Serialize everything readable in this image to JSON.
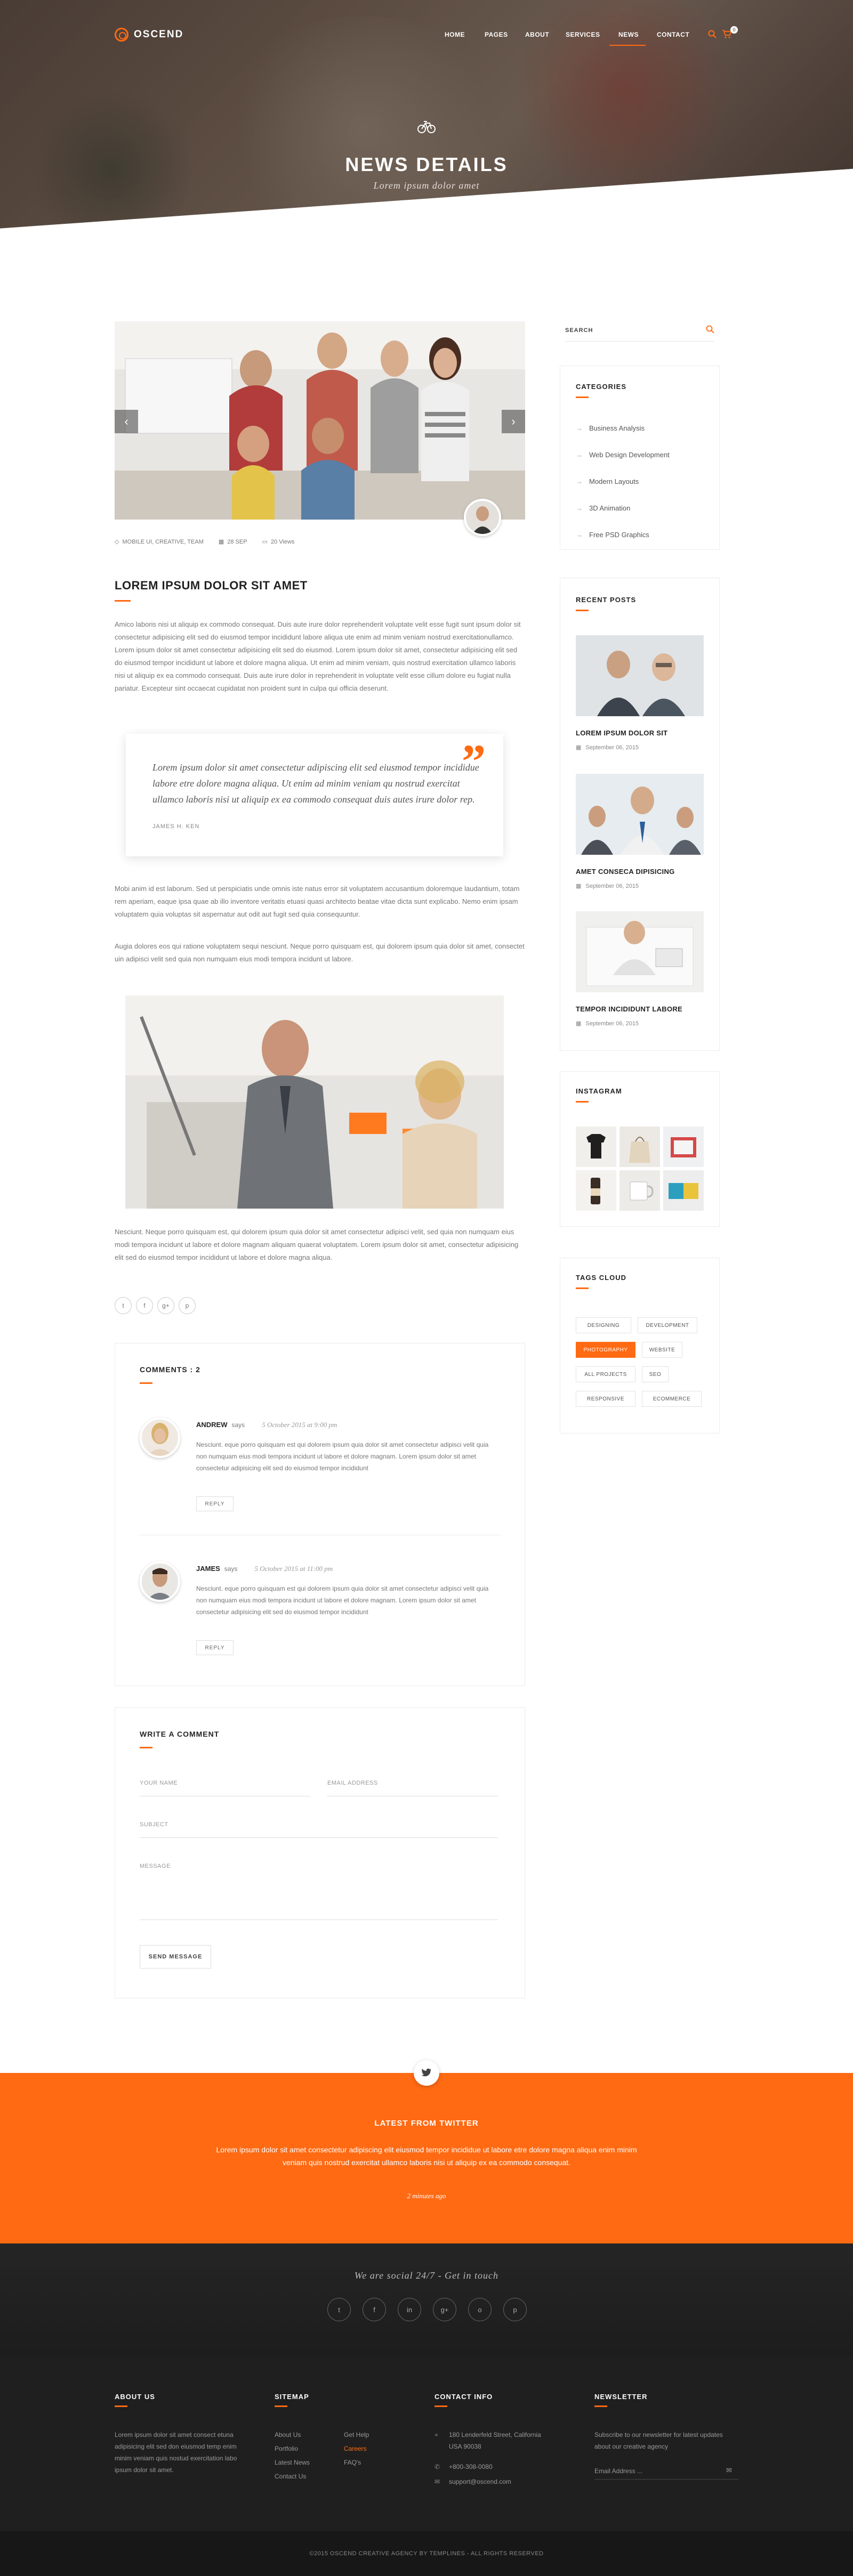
{
  "brand": {
    "name": "OSCEND",
    "accent": "#ff6a13"
  },
  "nav": {
    "items": [
      "HOME",
      "PAGES",
      "ABOUT",
      "SERVICES",
      "NEWS",
      "CONTACT"
    ],
    "active": "NEWS",
    "cart_count": "0"
  },
  "hero": {
    "title": "NEWS DETAILS",
    "subtitle": "Lorem ipsum dolor amet"
  },
  "post": {
    "meta": {
      "categories": "MOBILE UI, CREATIVE, TEAM",
      "date": "28 SEP",
      "views": "20 Views"
    },
    "title": "LOREM IPSUM DOLOR SIT AMET",
    "para1": "Amico laboris nisi ut aliquip ex commodo consequat. Duis aute irure dolor reprehenderit voluptate velit esse fugit sunt ipsum dolor sit consectetur adipisicing elit sed do eiusmod tempor incididunt labore aliqua ute enim ad minim veniam nostrud exercitationullamco. Lorem ipsum dolor sit amet consectetur adipisicing elit sed do eiusmod. Lorem ipsum dolor sit amet, consectetur adipisicing elit sed do eiusmod tempor incididunt ut labore et dolore magna aliqua. Ut enim ad minim veniam, quis nostrud exercitation ullamco laboris nisi ut aliquip ex ea commodo consequat. Duis aute irure dolor in reprehenderit in voluptate velit esse cillum dolore eu fugiat nulla pariatur. Excepteur sint occaecat cupidatat non proident sunt in culpa qui officia deserunt.",
    "quote": {
      "text": "Lorem ipsum dolor sit amet consectetur adipiscing elit sed eiusmod tempor incididue labore etre dolore magna aliqua. Ut enim ad minim veniam qu nostrud exercitat ullamco laboris nisi ut aliquip ex ea commodo consequat duis autes irure dolor rep.",
      "author": "JAMES H. KEN"
    },
    "para2": "Mobi anim id est laborum. Sed ut perspiciatis unde omnis iste natus error sit voluptatem accusantium doloremque laudantium, totam rem aperiam, eaque ipsa quae ab illo inventore veritatis etuasi quasi architecto beatae vitae dicta sunt explicabo. Nemo enim ipsam voluptatem quia voluptas sit aspernatur aut odit aut fugit sed quia consequuntur.",
    "para3": "Augia dolores eos qui ratione voluptatem sequi nesciunt. Neque porro quisquam est, qui dolorem ipsum quia dolor sit amet, consectet uin adipisci velit sed quia non numquam eius modi tempora incidunt ut labore.",
    "para4": "Nesciunt. Neque porro quisquam est, qui dolorem ipsum quia dolor sit amet consectetur adipisci velit, sed quia non numquam eius modi tempora incidunt ut labore et dolore magnam aliquam quaerat voluptatem. Lorem ipsum dolor sit amet, consectetur adipisicing elit sed do eiusmod tempor incididunt ut labore et dolore magna aliqua.",
    "share": [
      "t",
      "f",
      "g+",
      "p"
    ]
  },
  "comments": {
    "title": "COMMENTS : 2",
    "says": "says",
    "reply": "REPLY",
    "items": [
      {
        "name": "ANDREW",
        "date": "5 October 2015 at 9:00 pm",
        "text": "Nesciunt. eque porro quisquam est qui dolorem ipsum quia dolor sit amet consectetur adipisci velit quia non numquam eius modi tempora incidunt ut labore et dolore magnam. Lorem ipsum dolor sit amet consectetur adipisicing elit sed do eiusmod tempor incididunt"
      },
      {
        "name": "JAMES",
        "date": "5 October 2015 at 11:00 pm",
        "text": "Nesciunt. eque porro quisquam est qui dolorem ipsum quia dolor sit amet consectetur adipisci velit quia non numquam eius modi tempora incidunt ut labore et dolore magnam. Lorem ipsum dolor sit amet consectetur adipisicing elit sed do eiusmod tempor incididunt"
      }
    ]
  },
  "form": {
    "title": "WRITE A COMMENT",
    "name": "YOUR NAME",
    "email": "EMAIL ADDRESS",
    "subject": "SUBJECT",
    "message": "MESSAGE",
    "button": "SEND MESSAGE"
  },
  "sidebar": {
    "search": "SEARCH",
    "categories_title": "CATEGORIES",
    "categories": [
      "Business Analysis",
      "Web Design Development",
      "Modern Layouts",
      "3D Animation",
      "Free PSD Graphics"
    ],
    "recent_title": "RECENT POSTS",
    "recent": [
      {
        "title": "LOREM IPSUM DOLOR SIT",
        "date": "September 06, 2015"
      },
      {
        "title": "AMET CONSECA DIPISICING",
        "date": "September 06, 2015"
      },
      {
        "title": "TEMPOR INCIDIDUNT LABORE",
        "date": "September 06, 2015"
      }
    ],
    "instagram_title": "INSTAGRAM",
    "tags_title": "TAGS CLOUD",
    "tags": [
      "DESIGNING",
      "DEVELOPMENT",
      "PHOTOGRAPHY",
      "WEBSITE",
      "ALL PROJECTS",
      "SEO",
      "RESPONSIVE",
      "ECOMMERCE"
    ],
    "active_tag": "PHOTOGRAPHY"
  },
  "twitter": {
    "title": "LATEST FROM TWITTER",
    "text": "Lorem ipsum dolor sit amet consectetur adipiscing elit eiusmod tempor incididue ut labore etre dolore magna aliqua enim minim veniam quis nostrud exercitat ullamco laboris nisi ut aliquip ex ea commodo consequat.",
    "time": "2 minutes ago"
  },
  "social": {
    "title": "We are social 24/7 - Get in touch",
    "icons": [
      "t",
      "f",
      "in",
      "g+",
      "o",
      "p"
    ]
  },
  "footer": {
    "about_title": "ABOUT US",
    "about_text": "Lorem ipsum dolor sit amet consect etuna adipisicing elit sed don eiusmod temp enim minim veniam quis nostud exercitation labo ipsum dolor sit amet.",
    "sitemap_title": "SITEMAP",
    "sitemap_col1": [
      "About Us",
      "Portfolio",
      "Latest News",
      "Contact Us"
    ],
    "sitemap_col2": [
      "Get Help",
      "Careers",
      "FAQ's"
    ],
    "contact_title": "CONTACT INFO",
    "address": "180 Lenderfeld Street, California USA 90038",
    "phone": "+800-308-0080",
    "email": "support@oscend.com",
    "newsletter_title": "NEWSLETTER",
    "newsletter_text": "Subscribe to our newsletter for latest updates about our creative agency",
    "newsletter_placeholder": "Email Address ...",
    "copyright": "©2015 OSCEND CREATIVE AGENCY BY TEMPLINES - ALL RIGHTS RESERVED"
  }
}
